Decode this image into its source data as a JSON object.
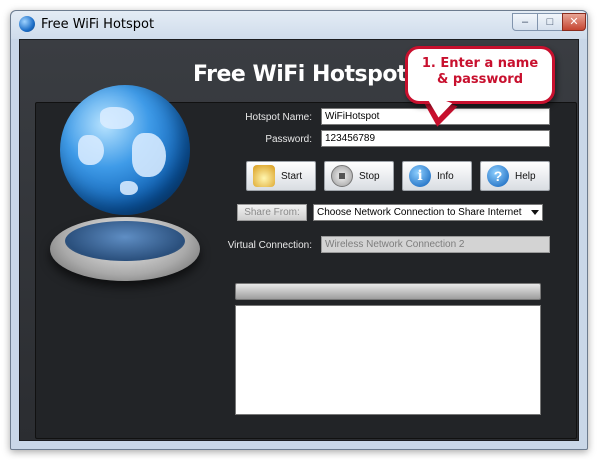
{
  "window": {
    "title": "Free WiFi Hotspot",
    "controls": {
      "minimize": "–",
      "maximize": "□",
      "close": "✕"
    }
  },
  "app": {
    "heading": "Free WiFi Hotspot"
  },
  "form": {
    "hotspot_name_label": "Hotspot Name:",
    "hotspot_name_value": "WiFiHotspot",
    "password_label": "Password:",
    "password_value": "123456789",
    "share_from_label": "Share From:",
    "share_from_selected": "Choose Network Connection to Share Internet",
    "virtual_connection_label": "Virtual Connection:",
    "virtual_connection_value": "Wireless Network Connection 2"
  },
  "buttons": {
    "start": "Start",
    "stop": "Stop",
    "info": "Info",
    "help": "Help"
  },
  "icons": {
    "start": "wifi-signal-icon",
    "stop": "stop-icon",
    "info": "info-icon",
    "help": "help-icon",
    "globe": "globe-icon"
  },
  "callout": {
    "line1": "1. Enter a name",
    "line2": "& password",
    "color": "#c8102e"
  },
  "progress": {
    "value": 0
  },
  "log": {
    "text": ""
  }
}
